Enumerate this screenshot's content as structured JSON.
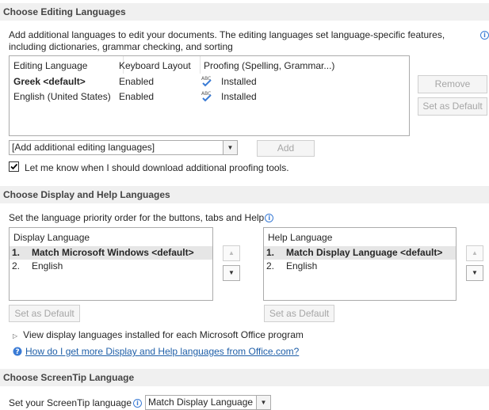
{
  "editing": {
    "header": "Choose Editing Languages",
    "description": "Add additional languages to edit your documents. The editing languages set language-specific features, including dictionaries, grammar checking, and sorting",
    "columns": [
      "Editing Language",
      "Keyboard Layout",
      "Proofing (Spelling, Grammar...)"
    ],
    "rows": [
      {
        "language": "Greek <default>",
        "keyboard": "Enabled",
        "proofing": "Installed",
        "bold": true
      },
      {
        "language": "English (United States)",
        "keyboard": "Enabled",
        "proofing": "Installed",
        "bold": false
      }
    ],
    "remove_label": "Remove",
    "set_default_label": "Set as Default",
    "add_dropdown_value": "[Add additional editing languages]",
    "add_label": "Add",
    "checkbox_label": "Let me know when I should download additional proofing tools.",
    "checkbox_checked": true
  },
  "display": {
    "header": "Choose Display and Help Languages",
    "description": "Set the language priority order for the buttons, tabs and Help",
    "display_list": {
      "title": "Display Language",
      "items": [
        {
          "num": "1.",
          "label": "Match Microsoft Windows <default>"
        },
        {
          "num": "2.",
          "label": "English"
        }
      ]
    },
    "help_list": {
      "title": "Help Language",
      "items": [
        {
          "num": "1.",
          "label": "Match Display Language <default>"
        },
        {
          "num": "2.",
          "label": "English"
        }
      ]
    },
    "set_default_label": "Set as Default",
    "view_installed_label": "View display languages installed for each Microsoft Office program",
    "more_link": "How do I get more Display and Help languages from Office.com?"
  },
  "screentip": {
    "header": "Choose ScreenTip Language",
    "label": "Set your ScreenTip language",
    "value": "Match Display Language"
  },
  "colors": {
    "header_bg": "#f0f0f0",
    "link": "#1f5fa8",
    "check_blue": "#3a7bd5",
    "selected_row": "#e6e6e6"
  }
}
